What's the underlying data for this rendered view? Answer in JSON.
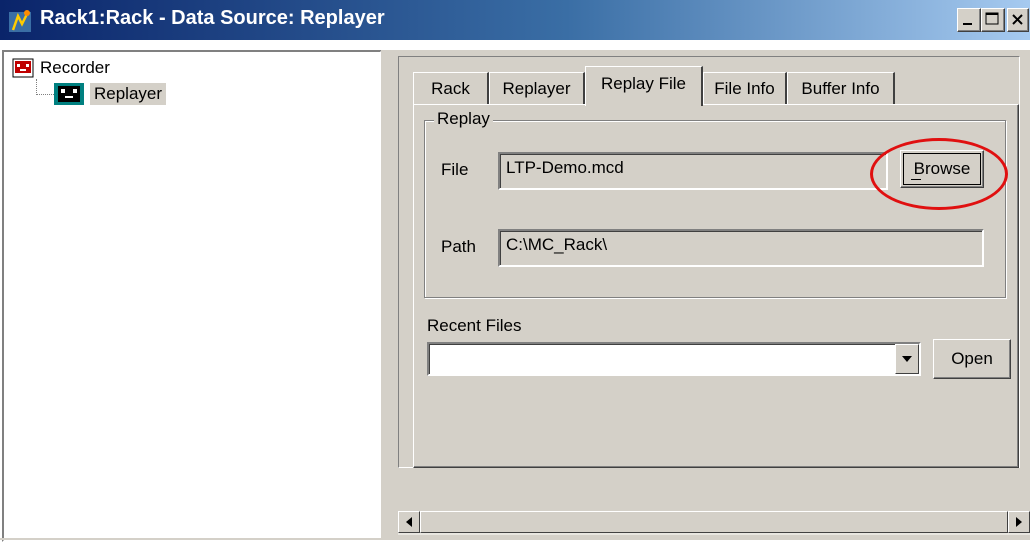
{
  "window": {
    "title": "Rack1:Rack - Data Source: Replayer",
    "caption_buttons": {
      "minimize": "_",
      "maximize": "☐",
      "close": "×"
    }
  },
  "tree": {
    "items": [
      {
        "label": "Recorder",
        "icon": "recorder-icon"
      },
      {
        "label": "Replayer",
        "icon": "replayer-icon",
        "selected": true
      }
    ]
  },
  "tabs": [
    {
      "label": "Rack",
      "active": false
    },
    {
      "label": "Replayer",
      "active": false
    },
    {
      "label": "Replay File",
      "active": true
    },
    {
      "label": "File Info",
      "active": false
    },
    {
      "label": "Buffer Info",
      "active": false
    }
  ],
  "replay_group": {
    "legend": "Replay",
    "file_label": "File",
    "file_value": "LTP-Demo.mcd",
    "browse_label": "Browse",
    "path_label": "Path",
    "path_value": "C:\\MC_Rack\\"
  },
  "recent_files": {
    "label": "Recent Files",
    "selected": "",
    "open_label": "Open"
  },
  "scrollbar": {
    "left_arrow": "◀",
    "right_arrow": "▶"
  },
  "colors": {
    "titlebar_start": "#0a246a",
    "titlebar_end": "#a6caf0",
    "face": "#d4d0c8",
    "annotation": "#e01010"
  }
}
